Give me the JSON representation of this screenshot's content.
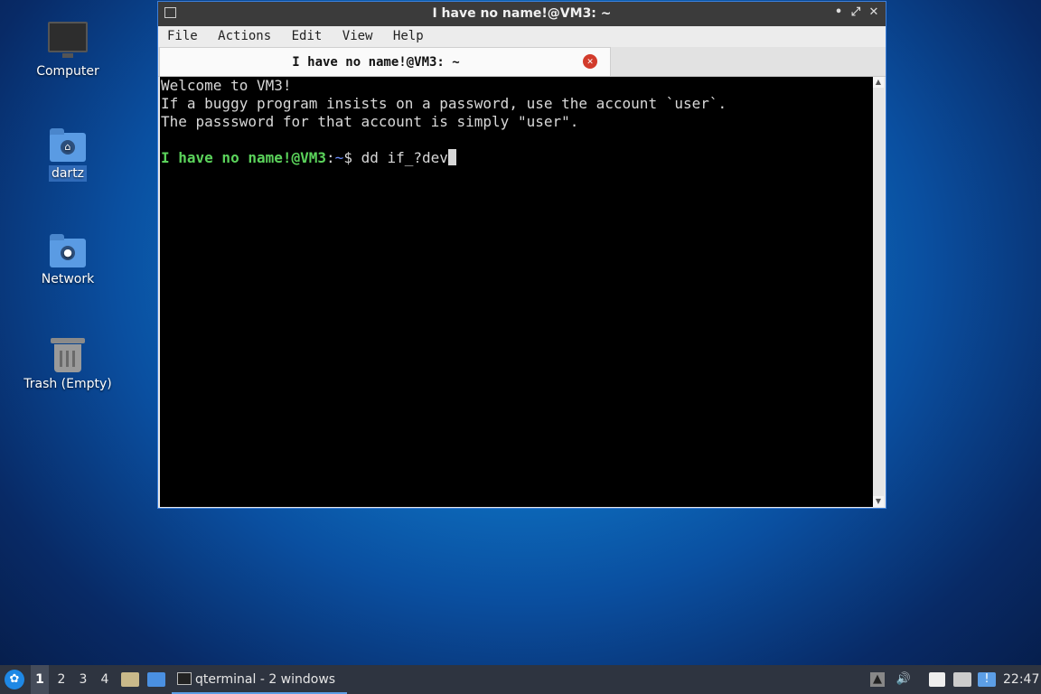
{
  "desktop": {
    "icons": [
      {
        "label": "Computer"
      },
      {
        "label": "dartz"
      },
      {
        "label": "Network"
      },
      {
        "label": "Trash (Empty)"
      }
    ]
  },
  "window": {
    "title": "I have no name!@VM3: ~",
    "controls": {
      "minimize": "•",
      "maximize": "⤢",
      "close": "✕"
    },
    "menu": [
      "File",
      "Actions",
      "Edit",
      "View",
      "Help"
    ],
    "tab": {
      "label": "I have no name!@VM3: ~",
      "close": "✕"
    },
    "terminal": {
      "lines": [
        "Welcome to VM3!",
        "If a buggy program insists on a password, use the account `user`.",
        "The passsword for that account is simply \"user\"."
      ],
      "prompt_user": "I have no name!@VM3",
      "prompt_sep": ":",
      "prompt_path": "~",
      "prompt_symbol": "$ ",
      "command": "dd if_?dev"
    }
  },
  "taskbar": {
    "desktops": [
      "1",
      "2",
      "3",
      "4"
    ],
    "active_desktop": "1",
    "task_label": "qterminal - 2 windows",
    "clock": "22:47"
  }
}
